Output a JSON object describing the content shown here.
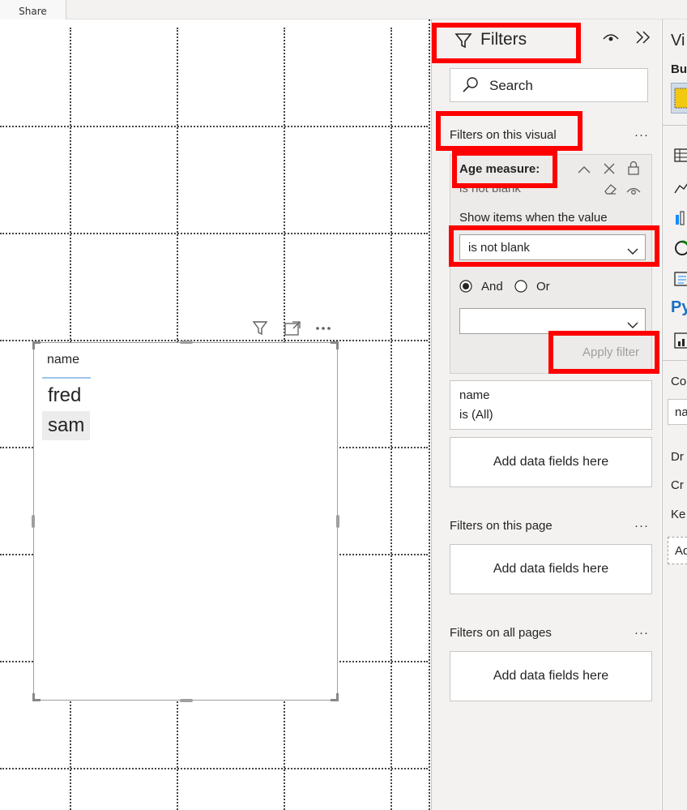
{
  "topbar": {
    "share_label": "Share"
  },
  "visual": {
    "column_header": "name",
    "rows": [
      "fred",
      "sam"
    ],
    "toolbar": {
      "filter_icon": "filter-icon",
      "focus_icon": "focus-mode-icon",
      "more_icon": "more-options-icon"
    }
  },
  "filters": {
    "title": "Filters",
    "search_placeholder": "Search",
    "visual_section_title": "Filters on this visual",
    "age_card": {
      "title": "Age measure:",
      "summary": "is not blank",
      "condition_label": "Show items when the value",
      "condition_value": "is not blank",
      "and_label": "And",
      "or_label": "Or",
      "second_condition_value": "",
      "apply_label": "Apply filter"
    },
    "name_card": {
      "title": "name",
      "summary": "is (All)"
    },
    "add_fields_label": "Add data fields here",
    "page_section_title": "Filters on this page",
    "page_add_fields_label": "Add data fields here",
    "all_pages_section_title": "Filters on all pages",
    "all_pages_add_fields_label": "Add data fields here",
    "more_glyph": "···"
  },
  "viz_pane": {
    "title": "Vi",
    "build_label": "Bu",
    "python_label": "Py",
    "columns_label": "Co",
    "name_chip": "na",
    "drill_label": "Dr",
    "cross_label": "Cr",
    "keep_label": "Ke",
    "add_label": "Ad"
  },
  "colors": {
    "accent_red": "#ff0000",
    "selection_blue": "#9ec3ea",
    "radio_checked": "#252423"
  }
}
